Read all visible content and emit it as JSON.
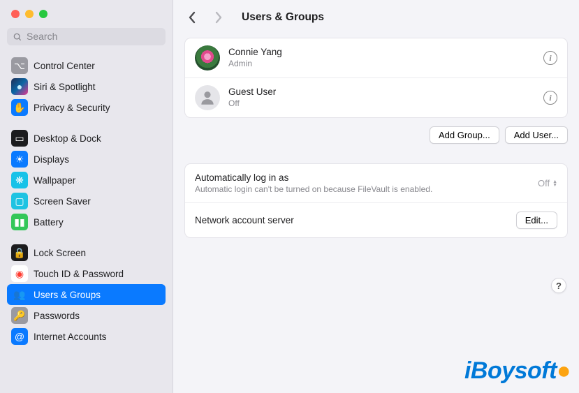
{
  "search": {
    "placeholder": "Search"
  },
  "sidebar": {
    "groups": [
      [
        {
          "label": "Control Center",
          "icon_bg": "#9a9aa1",
          "glyph": "⌥",
          "gcolor": "#fff"
        },
        {
          "label": "Siri & Spotlight",
          "icon_bg": "linear-gradient(135deg,#1f2e55,#0b66a4,#e9368e)",
          "glyph": "●",
          "gcolor": "#c6f0ff"
        },
        {
          "label": "Privacy & Security",
          "icon_bg": "#0a7aff",
          "glyph": "✋",
          "gcolor": "#fff"
        }
      ],
      [
        {
          "label": "Desktop & Dock",
          "icon_bg": "#1c1c1e",
          "glyph": "▭",
          "gcolor": "#fff"
        },
        {
          "label": "Displays",
          "icon_bg": "#0a7aff",
          "glyph": "☀",
          "gcolor": "#fff"
        },
        {
          "label": "Wallpaper",
          "icon_bg": "#17c2e8",
          "glyph": "❋",
          "gcolor": "#fff"
        },
        {
          "label": "Screen Saver",
          "icon_bg": "#1fc3e2",
          "glyph": "▢",
          "gcolor": "#fff"
        },
        {
          "label": "Battery",
          "icon_bg": "#34c759",
          "glyph": "▮▮",
          "gcolor": "#fff"
        }
      ],
      [
        {
          "label": "Lock Screen",
          "icon_bg": "#1c1c1e",
          "glyph": "🔒",
          "gcolor": "#fff"
        },
        {
          "label": "Touch ID & Password",
          "icon_bg": "#ffffff",
          "glyph": "◉",
          "gcolor": "#ff3b30"
        },
        {
          "label": "Users & Groups",
          "icon_bg": "#0a7aff",
          "glyph": "👥",
          "gcolor": "#fff",
          "selected": true
        },
        {
          "label": "Passwords",
          "icon_bg": "#9a9aa1",
          "glyph": "🔑",
          "gcolor": "#fff"
        },
        {
          "label": "Internet Accounts",
          "icon_bg": "#0a7aff",
          "glyph": "@",
          "gcolor": "#fff"
        }
      ]
    ]
  },
  "header": {
    "title": "Users & Groups"
  },
  "users": [
    {
      "name": "Connie Yang",
      "role": "Admin",
      "avatar": "img"
    },
    {
      "name": "Guest User",
      "role": "Off",
      "avatar": "guest"
    }
  ],
  "buttons": {
    "add_group": "Add Group...",
    "add_user": "Add User...",
    "edit": "Edit...",
    "help": "?"
  },
  "settings": {
    "auto_login_label": "Automatically log in as",
    "auto_login_sub": "Automatic login can't be turned on because FileVault is enabled.",
    "auto_login_value": "Off",
    "network_server_label": "Network account server"
  },
  "watermark": "iBoysoft"
}
